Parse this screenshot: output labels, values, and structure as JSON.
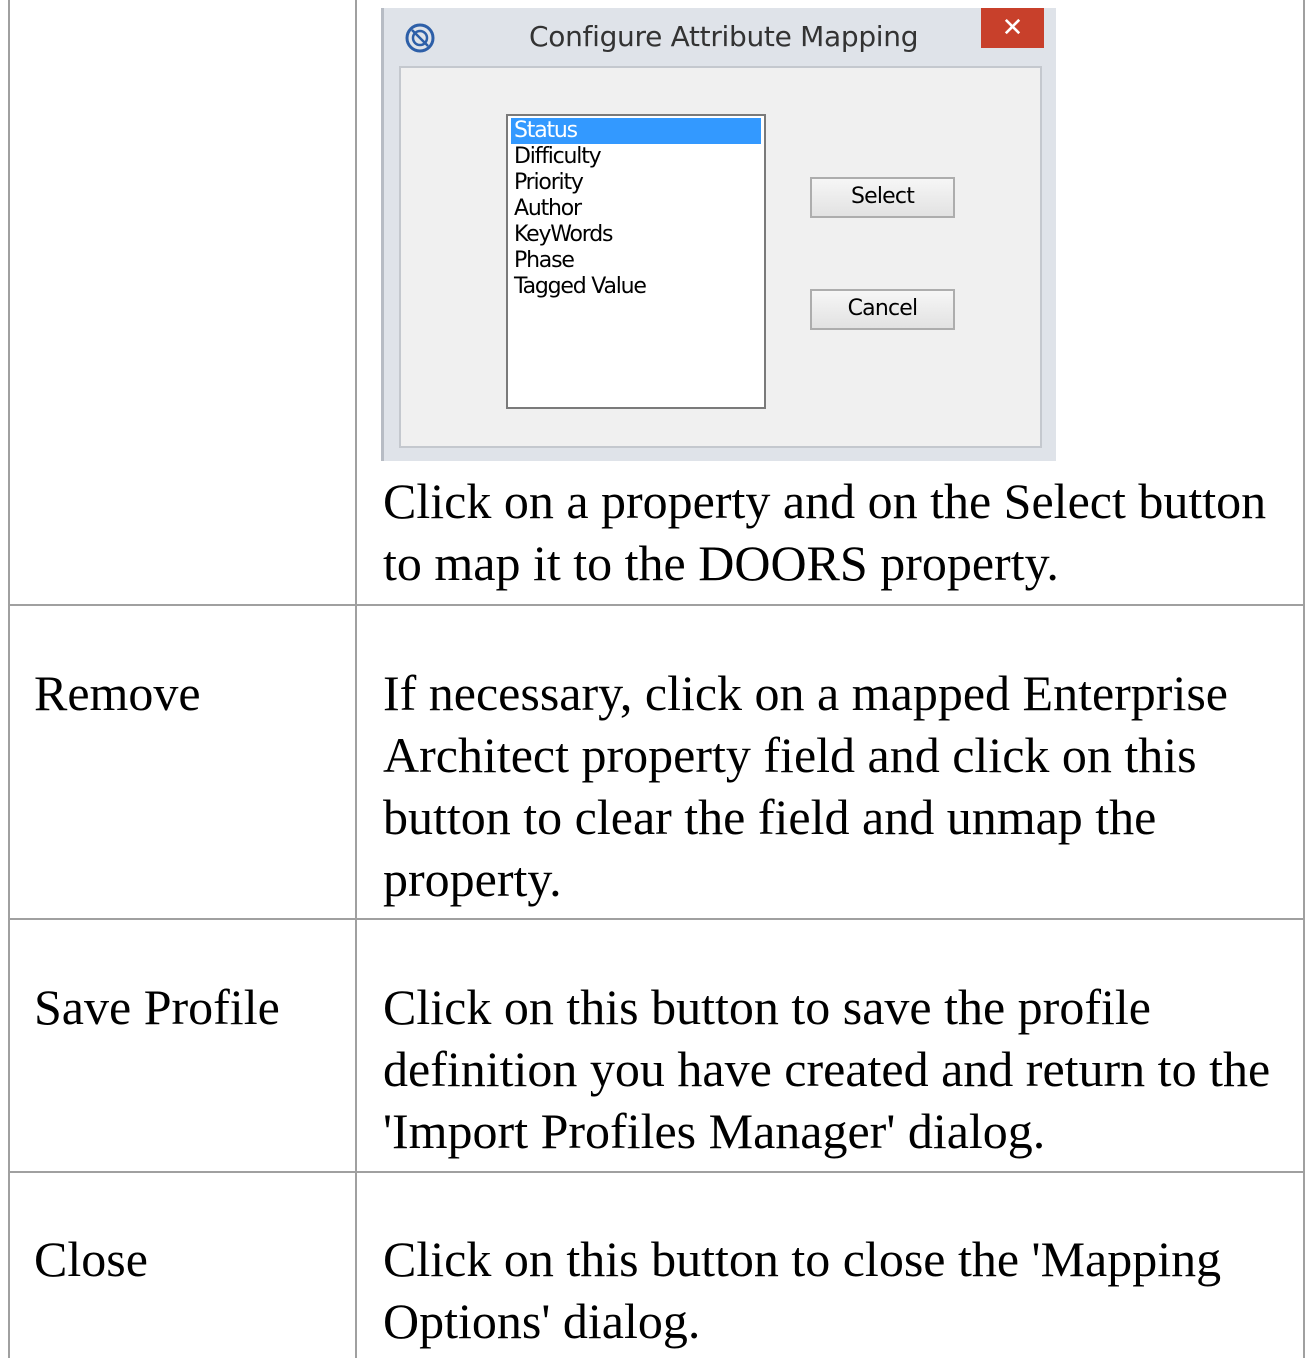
{
  "dialog": {
    "title": "Configure Attribute Mapping",
    "icon": "ea-logo-icon",
    "close_label": "✕",
    "list_items": [
      "Status",
      "Difficulty",
      "Priority",
      "Author",
      "KeyWords",
      "Phase",
      "Tagged Value"
    ],
    "selected_item": "Status",
    "select_label": "Select",
    "cancel_label": "Cancel"
  },
  "rows": [
    {
      "label": "",
      "description": "Click on a property and on the Select button to map it to the DOORS property."
    },
    {
      "label": "Remove",
      "description": "If necessary, click on a mapped Enterprise Architect property field and click on this button to clear the field and unmap the property."
    },
    {
      "label": "Save Profile",
      "description": "Click on this button to save the profile definition you have created and return to the 'Import Profiles Manager' dialog."
    },
    {
      "label": "Close",
      "description": "Click on this button to close the 'Mapping Options' dialog."
    }
  ],
  "colors": {
    "selection": "#3399ff",
    "close_button": "#c8402b",
    "grid_line": "#a0a0a0"
  }
}
